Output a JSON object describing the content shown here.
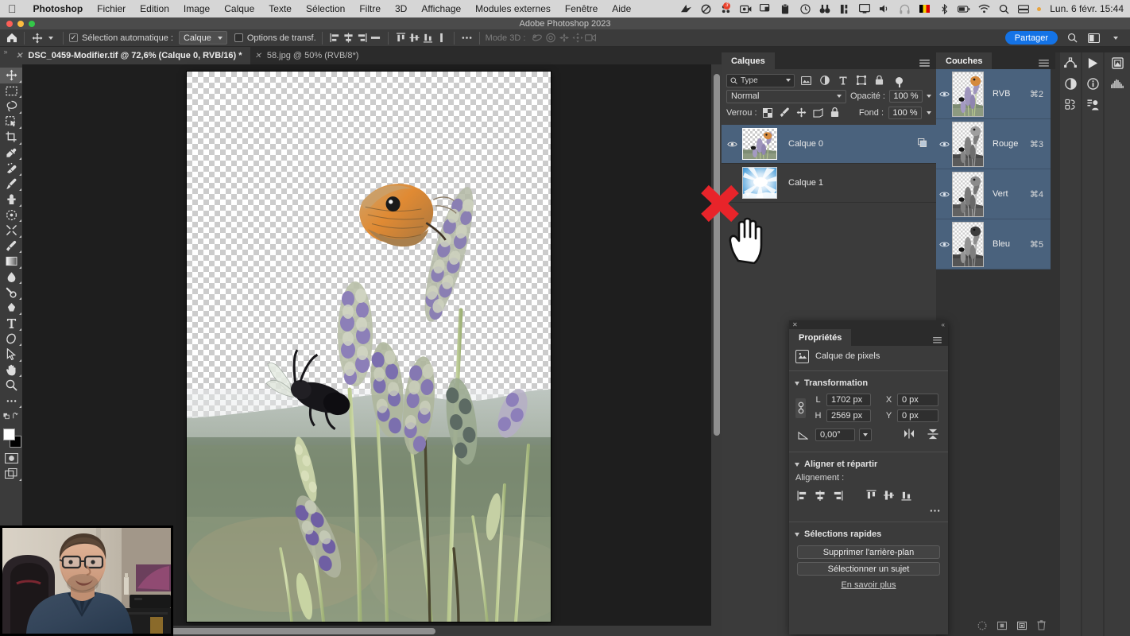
{
  "os_menubar": {
    "apple_icon": "apple-logo",
    "items": [
      {
        "label": "Photoshop",
        "bold": true
      },
      {
        "label": "Fichier",
        "bold": false
      },
      {
        "label": "Edition",
        "bold": false
      },
      {
        "label": "Image",
        "bold": false
      },
      {
        "label": "Calque",
        "bold": false
      },
      {
        "label": "Texte",
        "bold": false
      },
      {
        "label": "Sélection",
        "bold": false
      },
      {
        "label": "Filtre",
        "bold": false
      },
      {
        "label": "3D",
        "bold": false
      },
      {
        "label": "Affichage",
        "bold": false
      },
      {
        "label": "Modules externes",
        "bold": false
      },
      {
        "label": "Fenêtre",
        "bold": false
      },
      {
        "label": "Aide",
        "bold": false
      }
    ],
    "status_icons": [
      "bird-icon",
      "do-not-disturb-icon",
      "notification-icon",
      "screen-record-icon",
      "airplay-icon",
      "clipboard-icon",
      "time-machine-icon",
      "binoculars-icon",
      "stats-icon",
      "display-icon",
      "volume-icon",
      "headphones-icon",
      "belgium-flag-icon",
      "bluetooth-icon",
      "battery-icon",
      "wifi-icon",
      "spotlight-search-icon",
      "control-center-icon"
    ],
    "notification_badge": "3",
    "clock": "Lun. 6 févr.  15:44"
  },
  "window": {
    "title": "Adobe Photoshop 2023",
    "traffic_lights": [
      "#fc5f57",
      "#fdbc40",
      "#34c749"
    ]
  },
  "options_bar": {
    "home_icon": "home-icon",
    "tool_icon": "move-tool-icon",
    "auto_select_label": "Sélection automatique :",
    "auto_select_checked": true,
    "auto_select_value": "Calque",
    "transform_options_label": "Options de transf.",
    "transform_options_checked": false,
    "align_icons": [
      "align-left-edges-icon",
      "align-horizontal-centers-icon",
      "align-right-edges-icon",
      "distribute-horizontal-icon",
      "align-top-edges-icon",
      "align-vertical-centers-icon",
      "align-bottom-edges-icon",
      "distribute-vertical-icon"
    ],
    "more_icon": "ellipsis-icon",
    "mode3d_label": "Mode 3D :",
    "mode3d_icons": [
      "rotate-3d-icon",
      "roll-3d-icon",
      "pan-3d-icon",
      "slide-3d-icon",
      "camera-3d-icon"
    ],
    "share_label": "Partager",
    "search_icon": "search-icon",
    "workspace_icon": "workspace-icon"
  },
  "tabs": [
    {
      "label": "DSC_0459-Modifier.tif @ 72,6% (Calque 0, RVB/16) *",
      "active": true
    },
    {
      "label": "58.jpg @ 50% (RVB/8*)",
      "active": false
    }
  ],
  "toolbar": {
    "tools": [
      {
        "name": "move-tool",
        "selected": true,
        "flyout": true
      },
      {
        "name": "rectangular-marquee-tool",
        "selected": false,
        "flyout": true
      },
      {
        "name": "lasso-tool",
        "selected": false,
        "flyout": true
      },
      {
        "name": "object-selection-tool",
        "selected": false,
        "flyout": true
      },
      {
        "name": "crop-tool",
        "selected": false,
        "flyout": true
      },
      {
        "name": "eyedropper-tool",
        "selected": false,
        "flyout": true
      },
      {
        "name": "spot-healing-brush-tool",
        "selected": false,
        "flyout": true
      },
      {
        "name": "brush-tool",
        "selected": false,
        "flyout": true
      },
      {
        "name": "patch-tool",
        "selected": false,
        "flyout": true
      },
      {
        "name": "clone-stamp-tool",
        "selected": false,
        "flyout": true
      },
      {
        "name": "history-brush-tool",
        "selected": false,
        "flyout": true
      },
      {
        "name": "eraser-tool",
        "selected": false,
        "flyout": true
      },
      {
        "name": "gradient-tool",
        "selected": false,
        "flyout": true
      },
      {
        "name": "blur-tool",
        "selected": false,
        "flyout": true
      },
      {
        "name": "dodge-tool",
        "selected": false,
        "flyout": true
      },
      {
        "name": "pen-tool",
        "selected": false,
        "flyout": true
      },
      {
        "name": "type-tool",
        "selected": false,
        "flyout": true
      },
      {
        "name": "path-selection-tool",
        "selected": false,
        "flyout": true
      },
      {
        "name": "direct-selection-tool",
        "selected": false,
        "flyout": true
      },
      {
        "name": "hand-tool",
        "selected": false,
        "flyout": true
      },
      {
        "name": "zoom-tool",
        "selected": false,
        "flyout": false
      },
      {
        "name": "edit-toolbar",
        "selected": false,
        "flyout": false
      },
      {
        "name": "quick-mask-toggle",
        "selected": false,
        "flyout": false
      },
      {
        "name": "screen-mode",
        "selected": false,
        "flyout": true
      }
    ],
    "foreground_color": "#ffffff",
    "background_color": "#000000"
  },
  "layers_panel": {
    "tab_label": "Calques",
    "menu_icon": "panel-menu-icon",
    "filter": {
      "search_icon": "search-icon",
      "value": "Type",
      "type_icons": [
        "pixel-filter-icon",
        "adjustment-filter-icon",
        "text-filter-icon",
        "shape-filter-icon",
        "smart-object-filter-icon"
      ],
      "toggle_icon": "filter-toggle-icon"
    },
    "blend_mode": "Normal",
    "opacity_label": "Opacité :",
    "opacity_value": "100 %",
    "lock_label": "Verrou :",
    "lock_icons": [
      "lock-transparency-icon",
      "lock-image-icon",
      "lock-position-icon",
      "lock-artboard-icon",
      "lock-all-icon"
    ],
    "fill_label": "Fond :",
    "fill_value": "100 %",
    "layers": [
      {
        "name": "Calque 0",
        "visible": true,
        "selected": true,
        "badge": "smart-link-icon",
        "thumb": "butterfly-lavender-thumb"
      },
      {
        "name": "Calque 1",
        "visible": false,
        "selected": false,
        "badge": "",
        "thumb": "sky-clouds-thumb"
      }
    ]
  },
  "channels_panel": {
    "tab_label": "Couches",
    "menu_icon": "panel-menu-icon",
    "channels": [
      {
        "name": "RVB",
        "shortcut": "⌘2",
        "visible": true,
        "selected": true,
        "thumb": "rgb-composite-thumb"
      },
      {
        "name": "Rouge",
        "shortcut": "⌘3",
        "visible": true,
        "selected": true,
        "thumb": "red-channel-thumb"
      },
      {
        "name": "Vert",
        "shortcut": "⌘4",
        "visible": true,
        "selected": true,
        "thumb": "green-channel-thumb"
      },
      {
        "name": "Bleu",
        "shortcut": "⌘5",
        "visible": true,
        "selected": true,
        "thumb": "blue-channel-thumb"
      }
    ],
    "bottom_icons": [
      "load-channel-as-selection-icon",
      "save-selection-as-channel-icon",
      "new-channel-icon",
      "delete-channel-icon"
    ]
  },
  "right_rail": {
    "column_a": [
      "paths-icon",
      "adjustments-icon",
      "actions-history-icon"
    ],
    "column_b": [
      "play-actions-icon",
      "info-icon",
      "styles-icon"
    ],
    "column_c": [
      "libraries-icon",
      "histogram-icon"
    ]
  },
  "properties_panel": {
    "close_icon": "close-icon",
    "collapse_icon": "collapse-icon",
    "tab_label": "Propriétés",
    "menu_icon": "panel-menu-icon",
    "kind_icon": "pixel-layer-icon",
    "kind_label": "Calque de pixels",
    "transform": {
      "section_label": "Transformation",
      "link_icon": "link-aspect-ratio-icon",
      "w_label": "L",
      "w_value": "1702 px",
      "h_label": "H",
      "h_value": "2569 px",
      "x_label": "X",
      "x_value": "0 px",
      "y_label": "Y",
      "y_value": "0 px",
      "angle_icon": "angle-icon",
      "angle_value": "0,00°",
      "flip_h_icon": "flip-horizontal-icon",
      "flip_v_icon": "flip-vertical-icon"
    },
    "align": {
      "section_label": "Aligner et répartir",
      "alignment_label": "Alignement :",
      "icons": [
        "align-left-edges-icon",
        "align-horizontal-centers-icon",
        "align-right-edges-icon",
        "align-top-edges-icon",
        "align-vertical-centers-icon",
        "align-bottom-edges-icon"
      ],
      "more_icon": "ellipsis-icon"
    },
    "quick_actions": {
      "section_label": "Sélections rapides",
      "remove_bg_label": "Supprimer l'arrière-plan",
      "select_subject_label": "Sélectionner un sujet",
      "learn_more_label": "En savoir plus"
    }
  },
  "overlays": {
    "red_x_color": "#e8242a",
    "red_x_name": "red-x-annotation",
    "cursor_name": "pointing-hand-cursor",
    "webcam_name": "webcam-overlay"
  },
  "canvas": {
    "document_name": "transparent-butterfly-lavender-document",
    "scrollbar_h": "horizontal-scrollbar",
    "scrollbar_v": "vertical-scrollbar"
  }
}
